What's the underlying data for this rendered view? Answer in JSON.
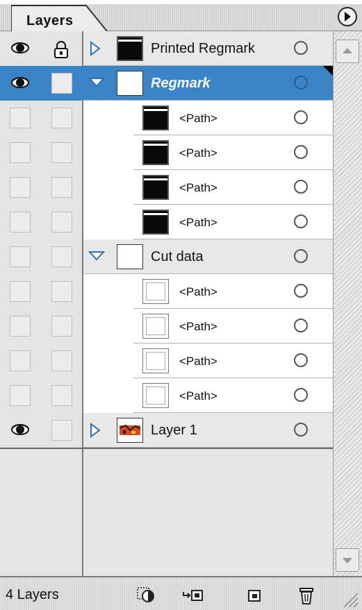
{
  "panel": {
    "tab_label": "Layers"
  },
  "colors": {
    "selection": "#3a83c4",
    "target_ring": "#555555"
  },
  "rows": [
    {
      "name": "Printed Regmark",
      "eye": true,
      "lock": true,
      "expander": "collapsed",
      "thumb": "black",
      "indent": 0,
      "selected": false,
      "kind": "layer"
    },
    {
      "name": "Regmark",
      "eye": true,
      "lock": false,
      "expander": "expanded",
      "thumb": "white",
      "indent": 0,
      "selected": true,
      "kind": "layer"
    },
    {
      "name": "<Path>",
      "eye": false,
      "lock": false,
      "expander": "none",
      "thumb": "black",
      "indent": 1,
      "selected": false,
      "kind": "path"
    },
    {
      "name": "<Path>",
      "eye": false,
      "lock": false,
      "expander": "none",
      "thumb": "black",
      "indent": 1,
      "selected": false,
      "kind": "path"
    },
    {
      "name": "<Path>",
      "eye": false,
      "lock": false,
      "expander": "none",
      "thumb": "black",
      "indent": 1,
      "selected": false,
      "kind": "path"
    },
    {
      "name": "<Path>",
      "eye": false,
      "lock": false,
      "expander": "none",
      "thumb": "black",
      "indent": 1,
      "selected": false,
      "kind": "path"
    },
    {
      "name": "Cut data",
      "eye": false,
      "lock": false,
      "expander": "expanded",
      "thumb": "white",
      "indent": 0,
      "selected": false,
      "kind": "layer"
    },
    {
      "name": "<Path>",
      "eye": false,
      "lock": false,
      "expander": "none",
      "thumb": "whitein",
      "indent": 1,
      "selected": false,
      "kind": "path"
    },
    {
      "name": "<Path>",
      "eye": false,
      "lock": false,
      "expander": "none",
      "thumb": "whitein",
      "indent": 1,
      "selected": false,
      "kind": "path"
    },
    {
      "name": "<Path>",
      "eye": false,
      "lock": false,
      "expander": "none",
      "thumb": "whitein",
      "indent": 1,
      "selected": false,
      "kind": "path"
    },
    {
      "name": "<Path>",
      "eye": false,
      "lock": false,
      "expander": "none",
      "thumb": "whitein",
      "indent": 1,
      "selected": false,
      "kind": "path"
    },
    {
      "name": "Layer 1",
      "eye": true,
      "lock": false,
      "expander": "collapsed",
      "thumb": "art",
      "indent": 0,
      "selected": false,
      "kind": "layer"
    }
  ],
  "footer": {
    "layer_count": "4 Layers",
    "icons": [
      "make-clipping-mask-icon",
      "new-sublayer-icon",
      "new-layer-icon",
      "trash-icon"
    ]
  }
}
